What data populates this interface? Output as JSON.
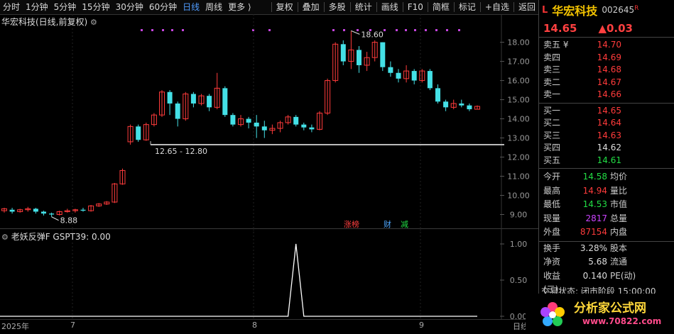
{
  "toolbar": {
    "left_items": [
      "分时",
      "1分钟",
      "5分钟",
      "15分钟",
      "30分钟",
      "60分钟",
      "日线",
      "周线",
      "更多 ⟩"
    ],
    "active": "日线",
    "right_items": [
      "复权",
      "叠加",
      "多股",
      "统计",
      "画线",
      "F10",
      "简框",
      "标记",
      "+自选",
      "返回"
    ]
  },
  "chart": {
    "title": "华宏科技(日线,前复权)",
    "ytick_labels": [
      "18.00",
      "17.00",
      "16.00",
      "15.00",
      "14.00",
      "13.00",
      "12.00",
      "11.00",
      "10.00",
      "9.00"
    ],
    "high_label": "18.60",
    "low_label": "8.88",
    "range_label": "12.65 - 12.80",
    "events": [
      {
        "text": "涨榜",
        "color": "#ff4040"
      },
      {
        "text": "财",
        "color": "#4fa8ff"
      },
      {
        "text": "减",
        "color": "#22dd44"
      }
    ],
    "x_labels": [
      "2025年",
      "7",
      "8",
      "9",
      "日线"
    ]
  },
  "indicator": {
    "title": "老妖反弹F  GSPT39: 0.00",
    "ytick_labels": [
      "1.00",
      "0.50",
      "0.00"
    ]
  },
  "quote": {
    "prefix": "L",
    "name": "华宏科技",
    "code": "002645",
    "suffix": "R",
    "price": "14.65",
    "change": "▲0.03",
    "asks": [
      {
        "label": "卖五 ¥",
        "price": "14.70"
      },
      {
        "label": "卖四",
        "price": "14.69"
      },
      {
        "label": "卖三",
        "price": "14.68"
      },
      {
        "label": "卖二",
        "price": "14.67"
      },
      {
        "label": "卖一",
        "price": "14.66"
      }
    ],
    "bids": [
      {
        "label": "买一",
        "price": "14.65",
        "color": "red"
      },
      {
        "label": "买二",
        "price": "14.64",
        "color": "red"
      },
      {
        "label": "买三",
        "price": "14.63",
        "color": "red"
      },
      {
        "label": "买四",
        "price": "14.62",
        "color": "white"
      },
      {
        "label": "买五",
        "price": "14.61",
        "color": "green"
      }
    ],
    "stats": [
      {
        "k": "今开",
        "v": "14.58",
        "c": "green",
        "k2": "均价"
      },
      {
        "k": "最高",
        "v": "14.94",
        "c": "red",
        "k2": "量比"
      },
      {
        "k": "最低",
        "v": "14.53",
        "c": "green",
        "k2": "市值"
      },
      {
        "k": "现量",
        "v": "2817",
        "c": "purple",
        "k2": "总量"
      },
      {
        "k": "外盘",
        "v": "87154",
        "c": "red",
        "k2": "内盘"
      }
    ],
    "stats2": [
      {
        "k": "换手",
        "v": "3.28%",
        "c": "white",
        "k2": "股本"
      },
      {
        "k": "净资",
        "v": "5.68",
        "c": "white",
        "k2": "流通"
      },
      {
        "k": "收益(三)",
        "v": "0.140",
        "c": "white",
        "k2": "PE(动)"
      }
    ],
    "status": "交易状态: 闭市阶段 15:00:00"
  },
  "logo": {
    "text": "分析家公式网",
    "sub": "www.70822.com"
  },
  "chart_data": {
    "type": "candlestick",
    "ylim": [
      8.5,
      18.8
    ],
    "candles": [
      [
        9.2,
        9.3,
        9.1,
        9.35
      ],
      [
        9.25,
        9.15,
        9.05,
        9.35
      ],
      [
        9.15,
        9.25,
        9.1,
        9.3
      ],
      [
        9.25,
        9.3,
        9.15,
        9.4
      ],
      [
        9.3,
        9.15,
        9.05,
        9.35
      ],
      [
        9.15,
        9.05,
        8.95,
        9.2
      ],
      [
        9.05,
        9.0,
        8.88,
        9.1
      ],
      [
        9.0,
        9.15,
        8.95,
        9.2
      ],
      [
        9.15,
        9.2,
        9.1,
        9.3
      ],
      [
        9.2,
        9.25,
        9.1,
        9.3
      ],
      [
        9.25,
        9.2,
        9.15,
        9.35
      ],
      [
        9.2,
        9.45,
        9.15,
        9.5
      ],
      [
        9.45,
        9.55,
        9.4,
        9.6
      ],
      [
        9.55,
        9.65,
        9.5,
        9.7
      ],
      [
        9.65,
        10.6,
        9.6,
        10.65
      ],
      [
        10.6,
        11.3,
        10.55,
        11.4
      ],
      [
        12.8,
        13.6,
        12.65,
        13.7
      ],
      [
        13.6,
        12.9,
        12.8,
        13.7
      ],
      [
        12.9,
        13.7,
        12.85,
        13.8
      ],
      [
        13.7,
        14.2,
        13.6,
        14.3
      ],
      [
        14.2,
        15.4,
        14.1,
        15.5
      ],
      [
        15.4,
        14.8,
        14.2,
        15.5
      ],
      [
        14.8,
        14.0,
        13.6,
        14.9
      ],
      [
        14.0,
        15.3,
        13.9,
        15.4
      ],
      [
        15.3,
        14.8,
        14.6,
        15.4
      ],
      [
        14.8,
        15.2,
        14.7,
        15.3
      ],
      [
        15.2,
        14.6,
        14.4,
        15.3
      ],
      [
        14.6,
        15.6,
        14.5,
        16.4
      ],
      [
        15.6,
        14.2,
        14.1,
        15.7
      ],
      [
        14.2,
        13.7,
        13.6,
        14.3
      ],
      [
        13.7,
        14.0,
        13.6,
        14.2
      ],
      [
        14.0,
        13.8,
        13.5,
        14.1
      ],
      [
        13.8,
        13.6,
        13.0,
        14.2
      ],
      [
        13.6,
        13.4,
        13.0,
        13.9
      ],
      [
        13.4,
        13.5,
        13.2,
        13.7
      ],
      [
        13.5,
        13.8,
        13.3,
        13.9
      ],
      [
        13.8,
        14.1,
        13.7,
        14.2
      ],
      [
        14.1,
        13.7,
        13.6,
        14.2
      ],
      [
        13.7,
        13.55,
        13.4,
        13.8
      ],
      [
        13.55,
        13.45,
        13.3,
        13.7
      ],
      [
        13.45,
        14.3,
        13.4,
        14.4
      ],
      [
        14.3,
        16.0,
        14.2,
        16.1
      ],
      [
        16.0,
        17.9,
        15.9,
        18.0
      ],
      [
        17.9,
        17.0,
        16.8,
        18.1
      ],
      [
        17.0,
        17.6,
        16.6,
        18.6
      ],
      [
        17.6,
        16.8,
        16.4,
        17.8
      ],
      [
        16.8,
        17.2,
        16.5,
        17.5
      ],
      [
        17.2,
        18.0,
        17.0,
        18.1
      ],
      [
        18.0,
        16.7,
        16.5,
        18.0
      ],
      [
        16.7,
        16.4,
        16.2,
        17.0
      ],
      [
        16.4,
        16.1,
        15.9,
        16.6
      ],
      [
        16.1,
        16.5,
        15.9,
        16.8
      ],
      [
        16.5,
        16.0,
        15.8,
        16.6
      ],
      [
        16.0,
        16.5,
        15.9,
        16.6
      ],
      [
        16.5,
        15.6,
        15.5,
        16.6
      ],
      [
        15.6,
        14.9,
        14.8,
        15.8
      ],
      [
        14.9,
        14.6,
        14.4,
        15.0
      ],
      [
        14.6,
        14.8,
        14.5,
        15.0
      ],
      [
        14.8,
        14.7,
        14.6,
        15.0
      ],
      [
        14.7,
        14.5,
        14.4,
        14.8
      ],
      [
        14.5,
        14.65,
        14.5,
        14.7
      ]
    ],
    "indicator_values": {
      "x_peak_index": 37,
      "peak_value": 1.0,
      "baseline": 0.0
    }
  }
}
